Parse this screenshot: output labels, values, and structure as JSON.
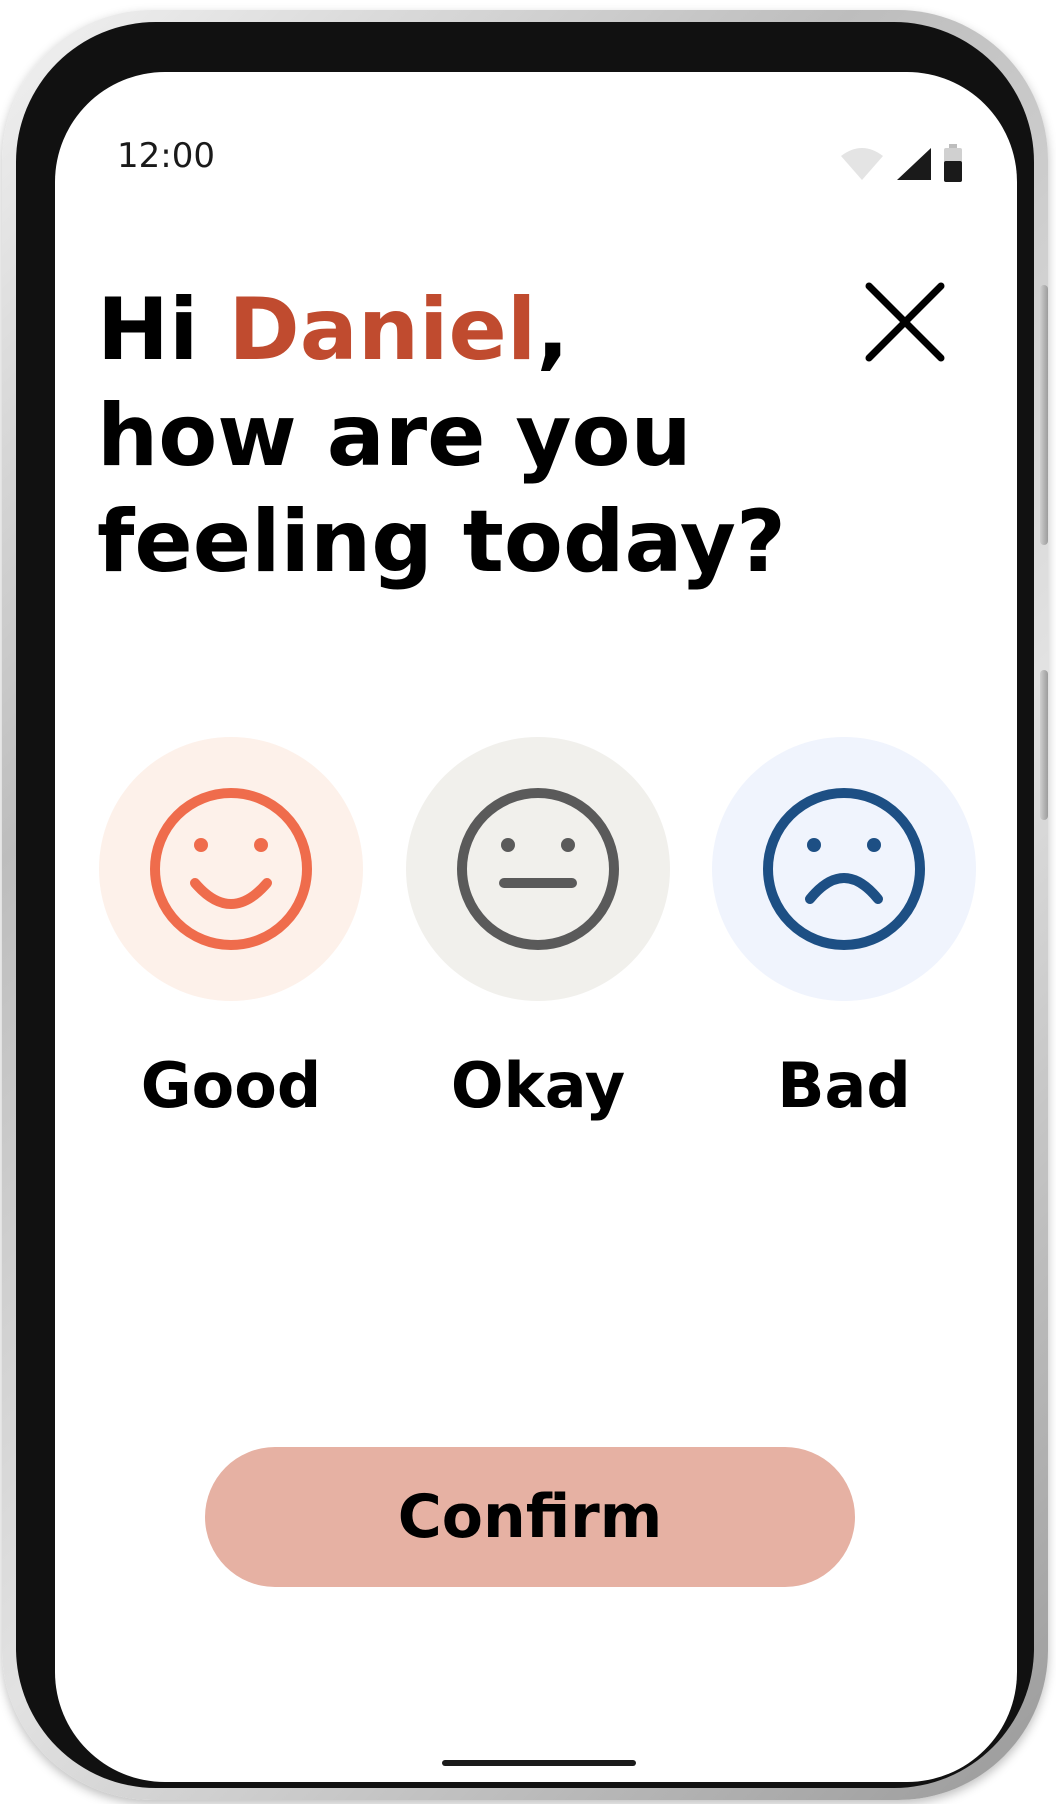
{
  "status_bar": {
    "time": "12:00"
  },
  "greeting": {
    "prefix": "Hi ",
    "name": "Daniel",
    "suffix": ",",
    "line2": "how are you",
    "line3": "feeling today?"
  },
  "moods": [
    {
      "label": "Good",
      "icon": "smile-face-icon",
      "color": "#ef6c4c",
      "bg": "#fdf1ea"
    },
    {
      "label": "Okay",
      "icon": "neutral-face-icon",
      "color": "#5a5a5a",
      "bg": "#f1f0ec"
    },
    {
      "label": "Bad",
      "icon": "sad-face-icon",
      "color": "#1d4f84",
      "bg": "#f0f4fd"
    }
  ],
  "confirm": {
    "label": "Confirm",
    "bg": "#e6b1a3"
  },
  "colors": {
    "accent_name": "#c04b2f"
  }
}
